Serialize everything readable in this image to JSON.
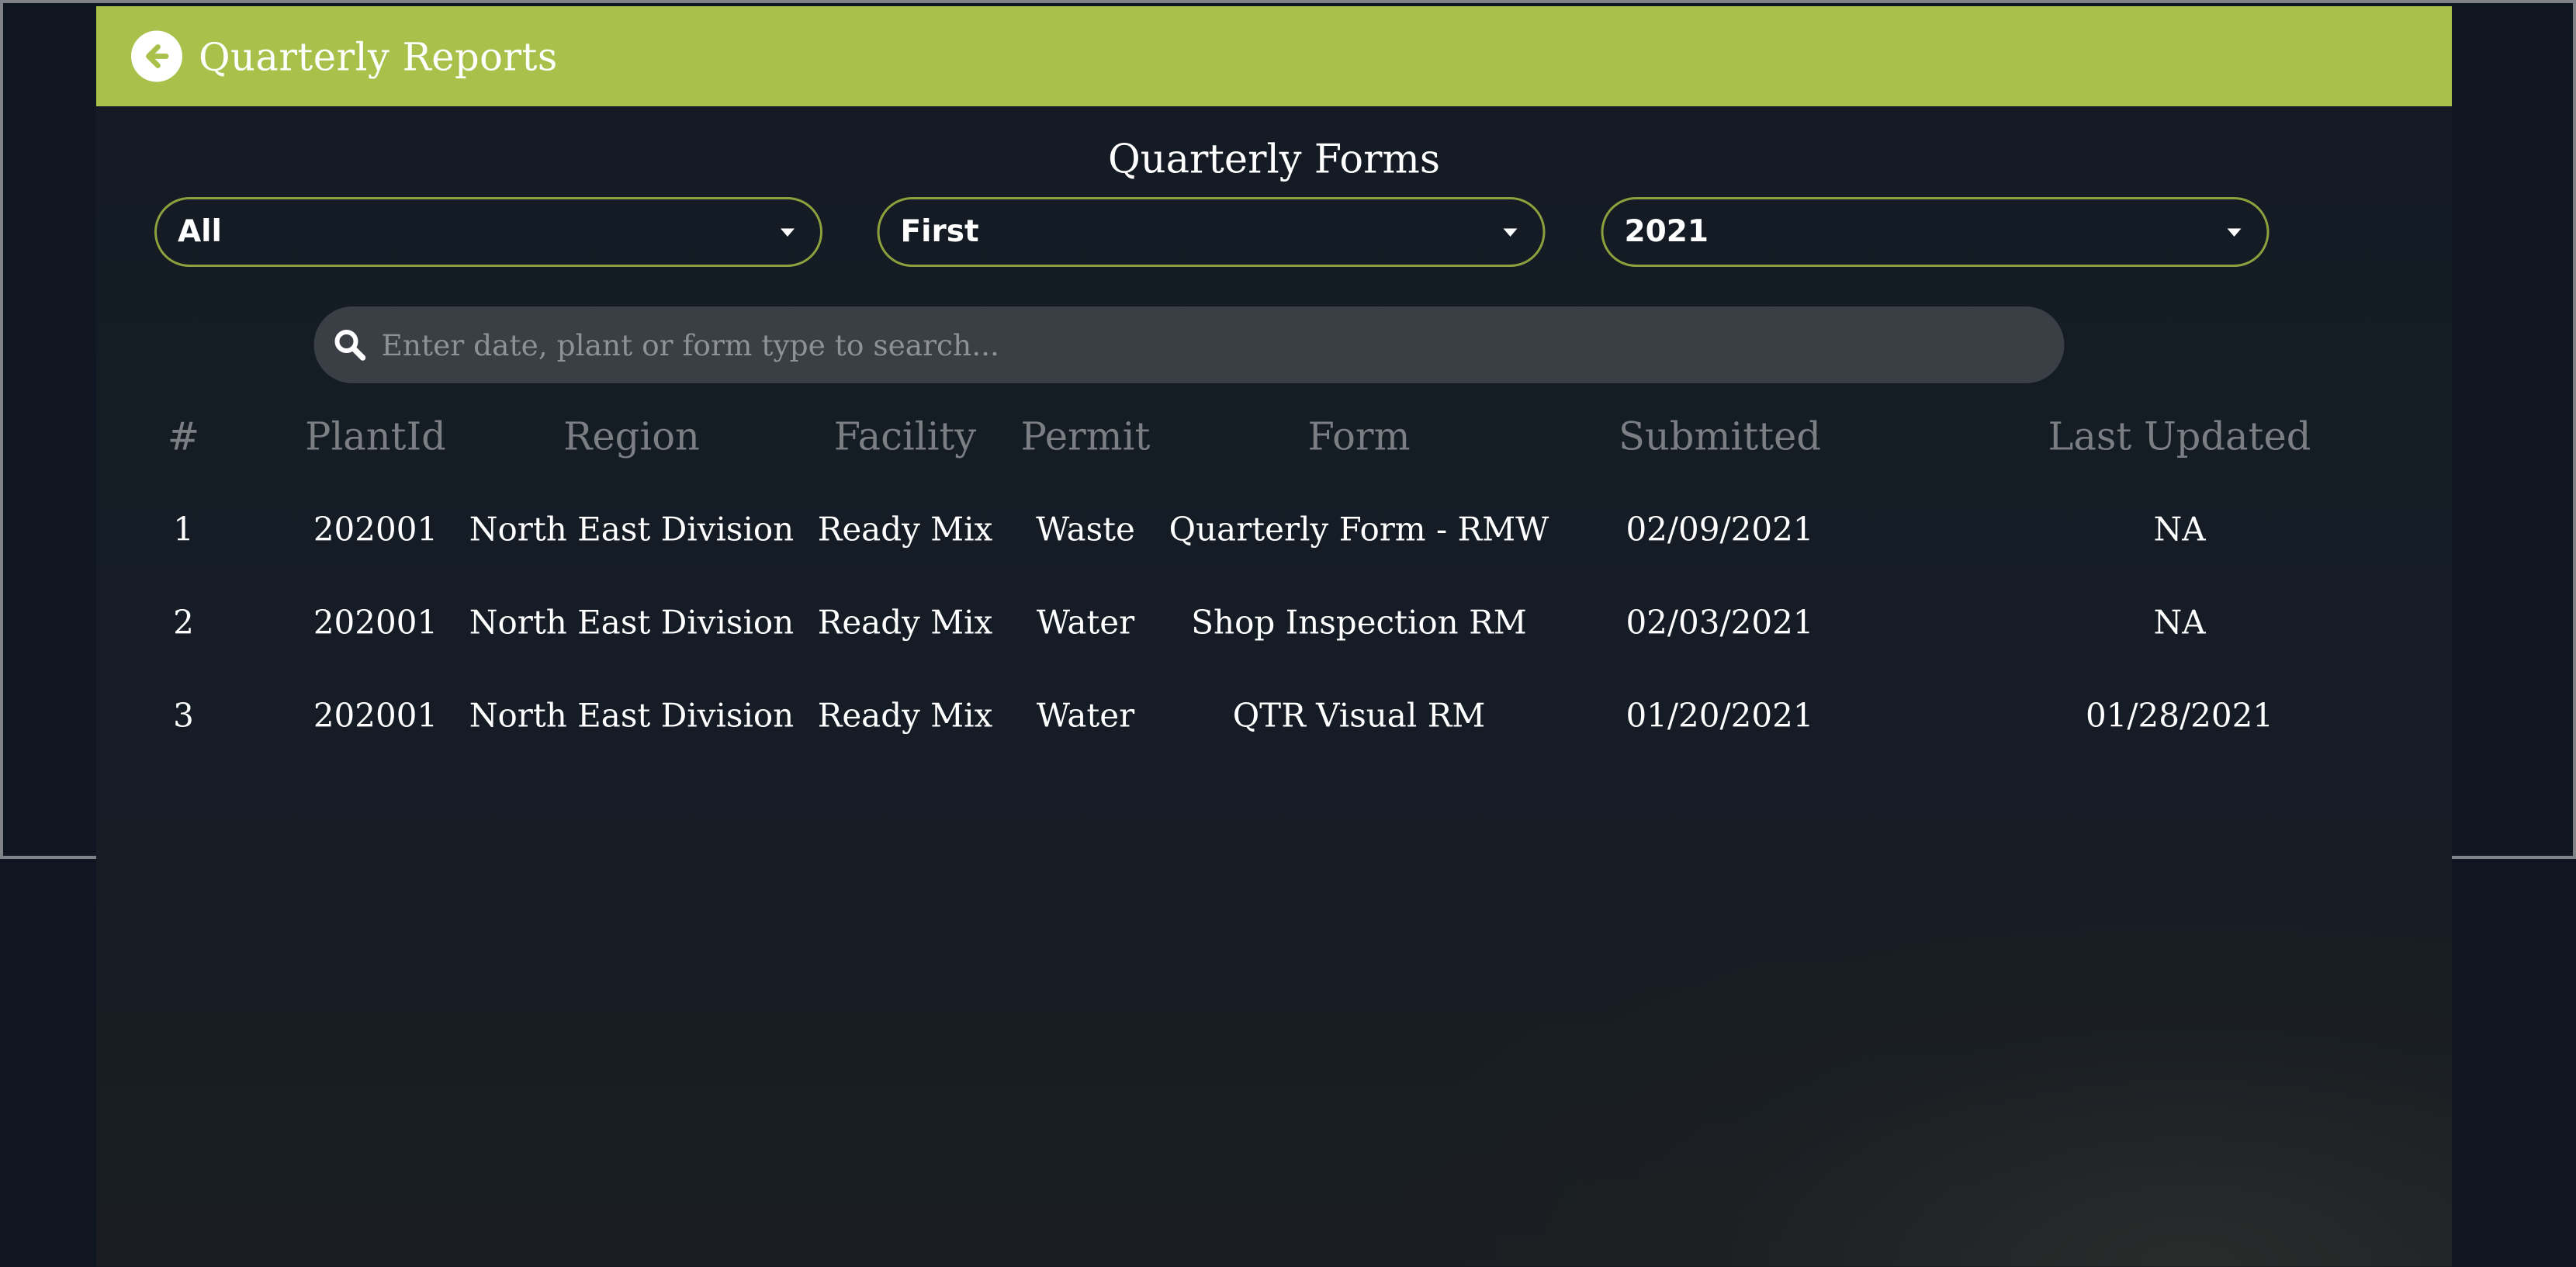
{
  "header": {
    "title": "Quarterly Reports",
    "back_icon": "arrow-left-circle-icon",
    "color": "#a9c04a"
  },
  "section_title": "Quarterly Forms",
  "filters": {
    "division": "All",
    "quarter": "First",
    "year": "2021"
  },
  "search": {
    "placeholder": "Enter date, plant or form type to search...",
    "value": ""
  },
  "table": {
    "columns": [
      "#",
      "PlantId",
      "Region",
      "Facility",
      "Permit",
      "Form",
      "Submitted",
      "Last Updated"
    ],
    "rows": [
      {
        "num": "1",
        "plant": "202001",
        "region": "North East Division",
        "facility": "Ready Mix",
        "permit": "Waste",
        "form": "Quarterly Form - RMW",
        "submitted": "02/09/2021",
        "updated": "NA"
      },
      {
        "num": "2",
        "plant": "202001",
        "region": "North East Division",
        "facility": "Ready Mix",
        "permit": "Water",
        "form": "Shop Inspection RM",
        "submitted": "02/03/2021",
        "updated": "NA"
      },
      {
        "num": "3",
        "plant": "202001",
        "region": "North East Division",
        "facility": "Ready Mix",
        "permit": "Water",
        "form": "QTR Visual RM",
        "submitted": "01/20/2021",
        "updated": "01/28/2021"
      }
    ]
  }
}
